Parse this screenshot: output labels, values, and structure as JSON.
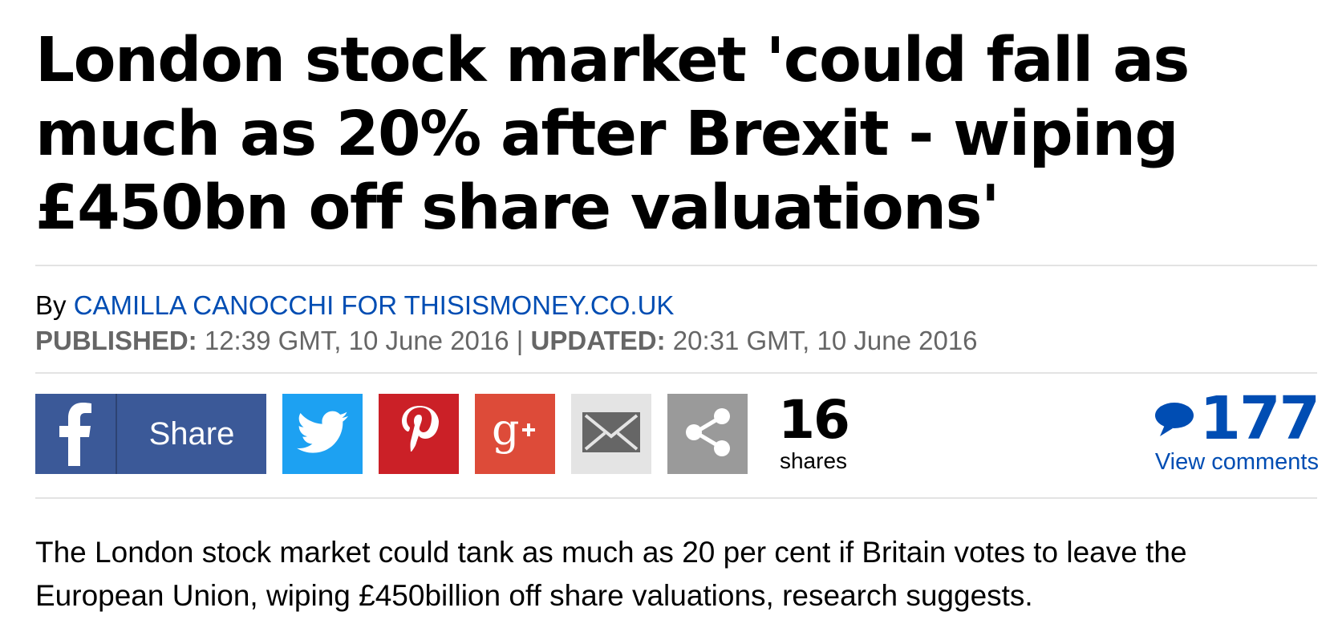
{
  "article": {
    "headline": "London stock market 'could fall as much as 20% after Brexit - wiping £450bn off share valuations'",
    "byline_prefix": "By ",
    "author": "CAMILLA CANOCCHI FOR THISISMONEY.CO.UK",
    "published_label": "PUBLISHED:",
    "published_value": " 12:39 GMT, 10 June 2016 ",
    "separator": "|",
    "updated_label": " UPDATED:",
    "updated_value": " 20:31 GMT, 10 June 2016",
    "lede": "The London stock market could tank as much as 20 per cent if Britain votes to leave the European Union, wiping £450billion off share valuations, research suggests."
  },
  "share_bar": {
    "facebook_label": "Share",
    "share_count": "16",
    "share_count_label": "shares",
    "icons": [
      "facebook-icon",
      "twitter-icon",
      "pinterest-icon",
      "google-plus-icon",
      "email-icon",
      "share-icon"
    ]
  },
  "comments": {
    "count": "177",
    "view_label": "View comments",
    "icon": "speech-bubble-icon"
  },
  "colors": {
    "link_blue": "#004db3",
    "facebook": "#3b5998",
    "twitter": "#1da1f2",
    "pinterest": "#cb2027",
    "google_plus": "#dd4b39",
    "email": "#e4e4e4",
    "share_more": "#9a9a9a",
    "meta_grey": "#666666",
    "rule": "#e3e3e3"
  }
}
